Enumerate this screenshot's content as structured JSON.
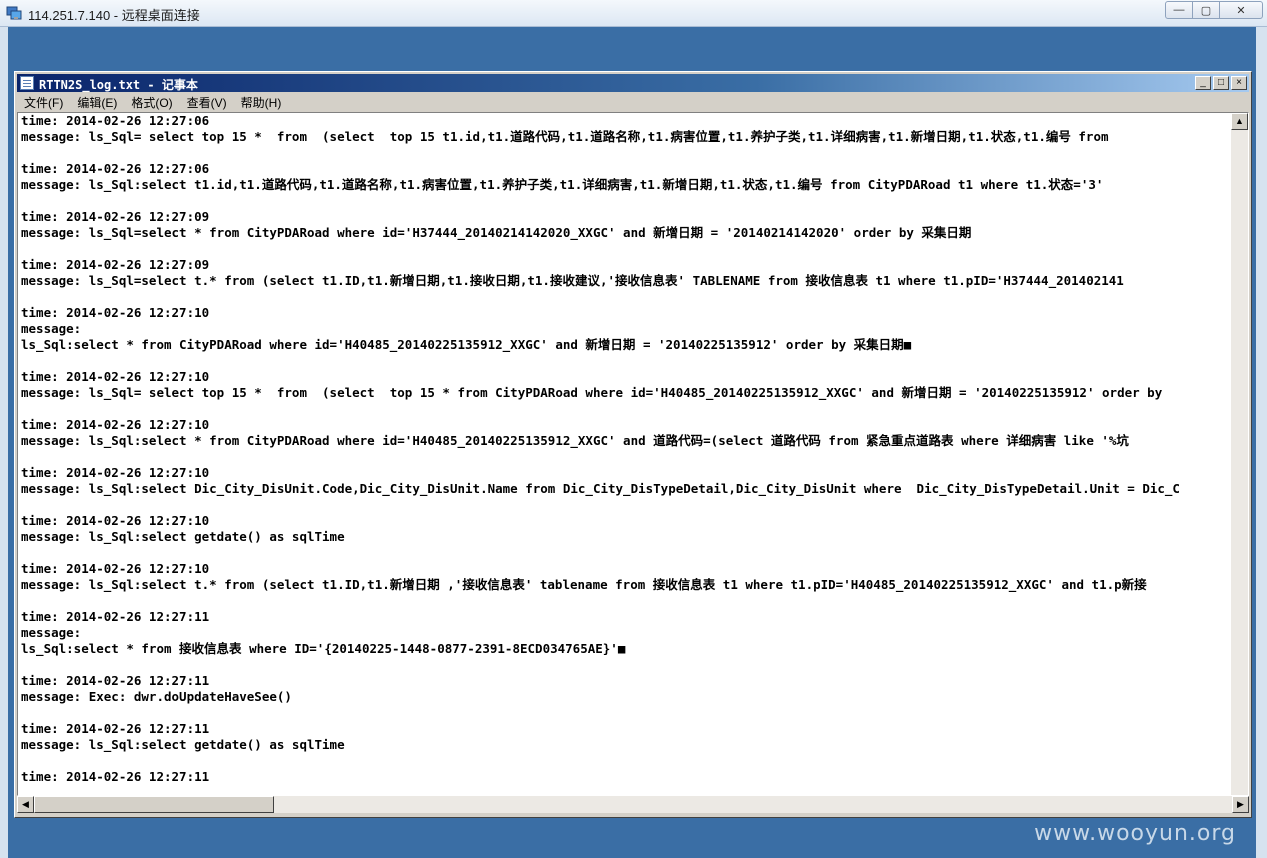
{
  "rdp": {
    "title": "114.251.7.140 - 远程桌面连接",
    "btn_minimize": "—",
    "btn_restore": "▢",
    "btn_close": "✕"
  },
  "notepad": {
    "title": "RTTN2S_log.txt - 记事本",
    "btn_min": "_",
    "btn_max": "□",
    "btn_close": "×",
    "menu": [
      "文件(F)",
      "编辑(E)",
      "格式(O)",
      "查看(V)",
      "帮助(H)"
    ],
    "lines": [
      "time: 2014-02-26 12:27:06",
      "message: ls_Sql= select top 15 *  from  (select  top 15 t1.id,t1.道路代码,t1.道路名称,t1.病害位置,t1.养护子类,t1.详细病害,t1.新增日期,t1.状态,t1.编号 from",
      "",
      "time: 2014-02-26 12:27:06",
      "message: ls_Sql:select t1.id,t1.道路代码,t1.道路名称,t1.病害位置,t1.养护子类,t1.详细病害,t1.新增日期,t1.状态,t1.编号 from CityPDARoad t1 where t1.状态='3'",
      "",
      "time: 2014-02-26 12:27:09",
      "message: ls_Sql=select * from CityPDARoad where id='H37444_20140214142020_XXGC' and 新增日期 = '20140214142020' order by 采集日期",
      "",
      "time: 2014-02-26 12:27:09",
      "message: ls_Sql=select t.* from (select t1.ID,t1.新增日期,t1.接收日期,t1.接收建议,'接收信息表' TABLENAME from 接收信息表 t1 where t1.pID='H37444_201402141",
      "",
      "time: 2014-02-26 12:27:10",
      "message:",
      "ls_Sql:select * from CityPDARoad where id='H40485_20140225135912_XXGC' and 新增日期 = '20140225135912' order by 采集日期■",
      "",
      "time: 2014-02-26 12:27:10",
      "message: ls_Sql= select top 15 *  from  (select  top 15 * from CityPDARoad where id='H40485_20140225135912_XXGC' and 新增日期 = '20140225135912' order by",
      "",
      "time: 2014-02-26 12:27:10",
      "message: ls_Sql:select * from CityPDARoad where id='H40485_20140225135912_XXGC' and 道路代码=(select 道路代码 from 紧急重点道路表 where 详细病害 like '%坑",
      "",
      "time: 2014-02-26 12:27:10",
      "message: ls_Sql:select Dic_City_DisUnit.Code,Dic_City_DisUnit.Name from Dic_City_DisTypeDetail,Dic_City_DisUnit where  Dic_City_DisTypeDetail.Unit = Dic_C",
      "",
      "time: 2014-02-26 12:27:10",
      "message: ls_Sql:select getdate() as sqlTime",
      "",
      "time: 2014-02-26 12:27:10",
      "message: ls_Sql:select t.* from (select t1.ID,t1.新增日期 ,'接收信息表' tablename from 接收信息表 t1 where t1.pID='H40485_20140225135912_XXGC' and t1.p新接",
      "",
      "time: 2014-02-26 12:27:11",
      "message:",
      "ls_Sql:select * from 接收信息表 where ID='{20140225-1448-0877-2391-8ECD034765AE}'■",
      "",
      "time: 2014-02-26 12:27:11",
      "message: Exec: dwr.doUpdateHaveSee()",
      "",
      "time: 2014-02-26 12:27:11",
      "message: ls_Sql:select getdate() as sqlTime",
      "",
      "time: 2014-02-26 12:27:11"
    ],
    "hscroll_left": "◀",
    "hscroll_right": "▶",
    "vscroll_up": "▲"
  },
  "watermark": "www.wooyun.org"
}
